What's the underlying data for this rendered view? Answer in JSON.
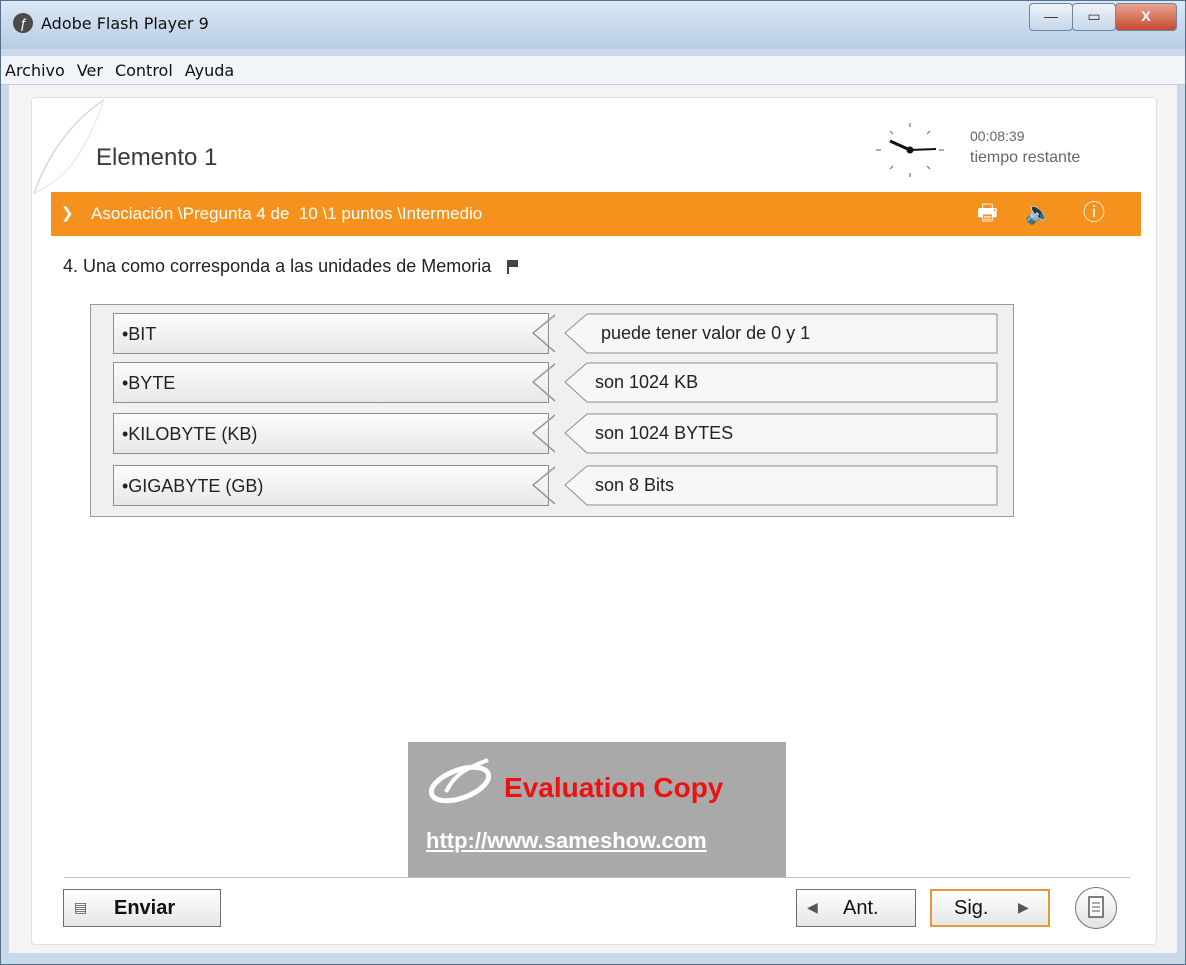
{
  "window": {
    "title": "Adobe Flash Player 9",
    "minimize_glyph": "—",
    "maximize_glyph": "▭",
    "close_glyph": "X"
  },
  "menu": {
    "items": [
      "Archivo",
      "Ver",
      "Control",
      "Ayuda"
    ]
  },
  "page": {
    "title": "Elemento 1"
  },
  "timer": {
    "value": "00:08:39",
    "label": "tiempo restante"
  },
  "question_bar": {
    "text": "Asociación \\Pregunta 4 de  10 \\1 puntos \\Intermedio",
    "icons": [
      "print-icon",
      "speaker-icon",
      "info-icon"
    ],
    "color": "#f5921e"
  },
  "question": {
    "text": "4.  Una como corresponda a las unidades de Memoria"
  },
  "matching": {
    "left": [
      "•BIT",
      "•BYTE",
      "•KILOBYTE (KB)",
      "•GIGABYTE (GB)"
    ],
    "right": [
      "puede tener valor de 0 y 1",
      "son 1024 KB",
      "son 1024 BYTES",
      "son 8 Bits"
    ]
  },
  "watermark": {
    "title": "Evaluation Copy",
    "url": "http://www.sameshow.com"
  },
  "footer": {
    "submit_label": "Enviar",
    "prev_label": "Ant.",
    "next_label": "Sig."
  }
}
